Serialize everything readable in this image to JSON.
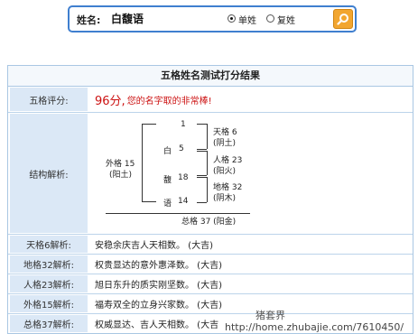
{
  "search": {
    "label": "姓名:",
    "value": "白馥语",
    "radio_single_label": "单姓",
    "radio_double_label": "复姓",
    "selected": "单姓"
  },
  "result": {
    "title": "五格姓名测试打分结果",
    "score_label": "五格评分:",
    "score_value": "96分,",
    "score_text": "您的名字取的非常棒!",
    "structure_label": "结构解析:",
    "structure": {
      "strokes": [
        "1",
        "5",
        "18",
        "14"
      ],
      "chars": [
        "白",
        "馥",
        "语"
      ],
      "tian": "天格 6",
      "tian_el": "(阴土)",
      "ren": "人格 23",
      "ren_el": "(阳火)",
      "di": "地格 32",
      "di_el": "(阴木)",
      "wai": "外格 15",
      "wai_el": "(阳土)",
      "zong": "总格 37 (阳金)"
    },
    "rows": [
      {
        "label": "天格6解析:",
        "text": "安稳余庆吉人天相数。 (大吉)"
      },
      {
        "label": "地格32解析:",
        "text": "权贵显达的意外惠泽数。 (大吉)"
      },
      {
        "label": "人格23解析:",
        "text": "旭日东升的质实刚坚数。 (大吉)"
      },
      {
        "label": "外格15解析:",
        "text": "福寿双全的立身兴家数。 (大吉)"
      },
      {
        "label": "总格37解析:",
        "text": "权威显达、吉人天相数。 (大吉"
      }
    ]
  },
  "watermark": "猪套界",
  "watermark_url": "http://home.zhubajie.com/7610450/"
}
